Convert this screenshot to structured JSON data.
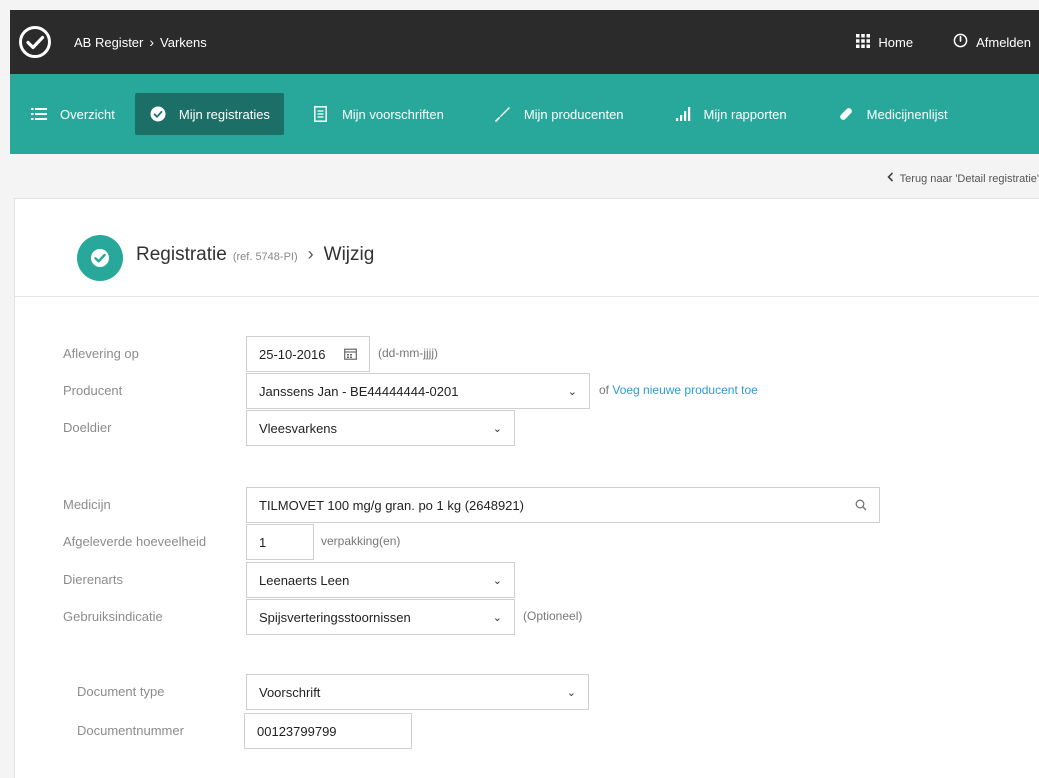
{
  "topbar": {
    "breadcrumb_root": "AB Register",
    "breadcrumb_current": "Varkens",
    "home_label": "Home",
    "logout_label": "Afmelden"
  },
  "nav": {
    "items": [
      {
        "label": "Overzicht",
        "icon": "list-icon"
      },
      {
        "label": "Mijn registraties",
        "icon": "check-circle-icon",
        "active": true
      },
      {
        "label": "Mijn voorschriften",
        "icon": "document-icon"
      },
      {
        "label": "Mijn producenten",
        "icon": "syringe-icon"
      },
      {
        "label": "Mijn rapporten",
        "icon": "bar-chart-icon"
      },
      {
        "label": "Medicijnenlijst",
        "icon": "pill-icon"
      }
    ]
  },
  "back_link": "Terug naar 'Detail registratie'",
  "header": {
    "title": "Registratie",
    "ref": "(ref. 5748-PI)",
    "subtitle": "Wijzig"
  },
  "form": {
    "aflevering": {
      "label": "Aflevering op",
      "value": "25-10-2016",
      "hint": "(dd-mm-jjjj)"
    },
    "producent": {
      "label": "Producent",
      "value": "Janssens Jan - BE44444444-0201",
      "or_text": "of",
      "link": "Voeg nieuwe producent toe"
    },
    "doeldier": {
      "label": "Doeldier",
      "value": "Vleesvarkens"
    },
    "medicijn": {
      "label": "Medicijn",
      "value": "TILMOVET 100 mg/g gran. po 1 kg (2648921)"
    },
    "hoeveelheid": {
      "label": "Afgeleverde hoeveelheid",
      "value": "1",
      "unit": "verpakking(en)"
    },
    "dierenarts": {
      "label": "Dierenarts",
      "value": "Leenaerts Leen"
    },
    "indicatie": {
      "label": "Gebruiksindicatie",
      "value": "Spijsverteringsstoornissen",
      "hint": "(Optioneel)"
    },
    "doctype": {
      "label": "Document type",
      "value": "Voorschrift"
    },
    "docnummer": {
      "label": "Documentnummer",
      "value": "00123799799"
    }
  },
  "colors": {
    "accent": "#27a89a",
    "accent_dark": "#1c6f67",
    "topbar": "#2b2b2b",
    "link": "#2e9bd6"
  }
}
